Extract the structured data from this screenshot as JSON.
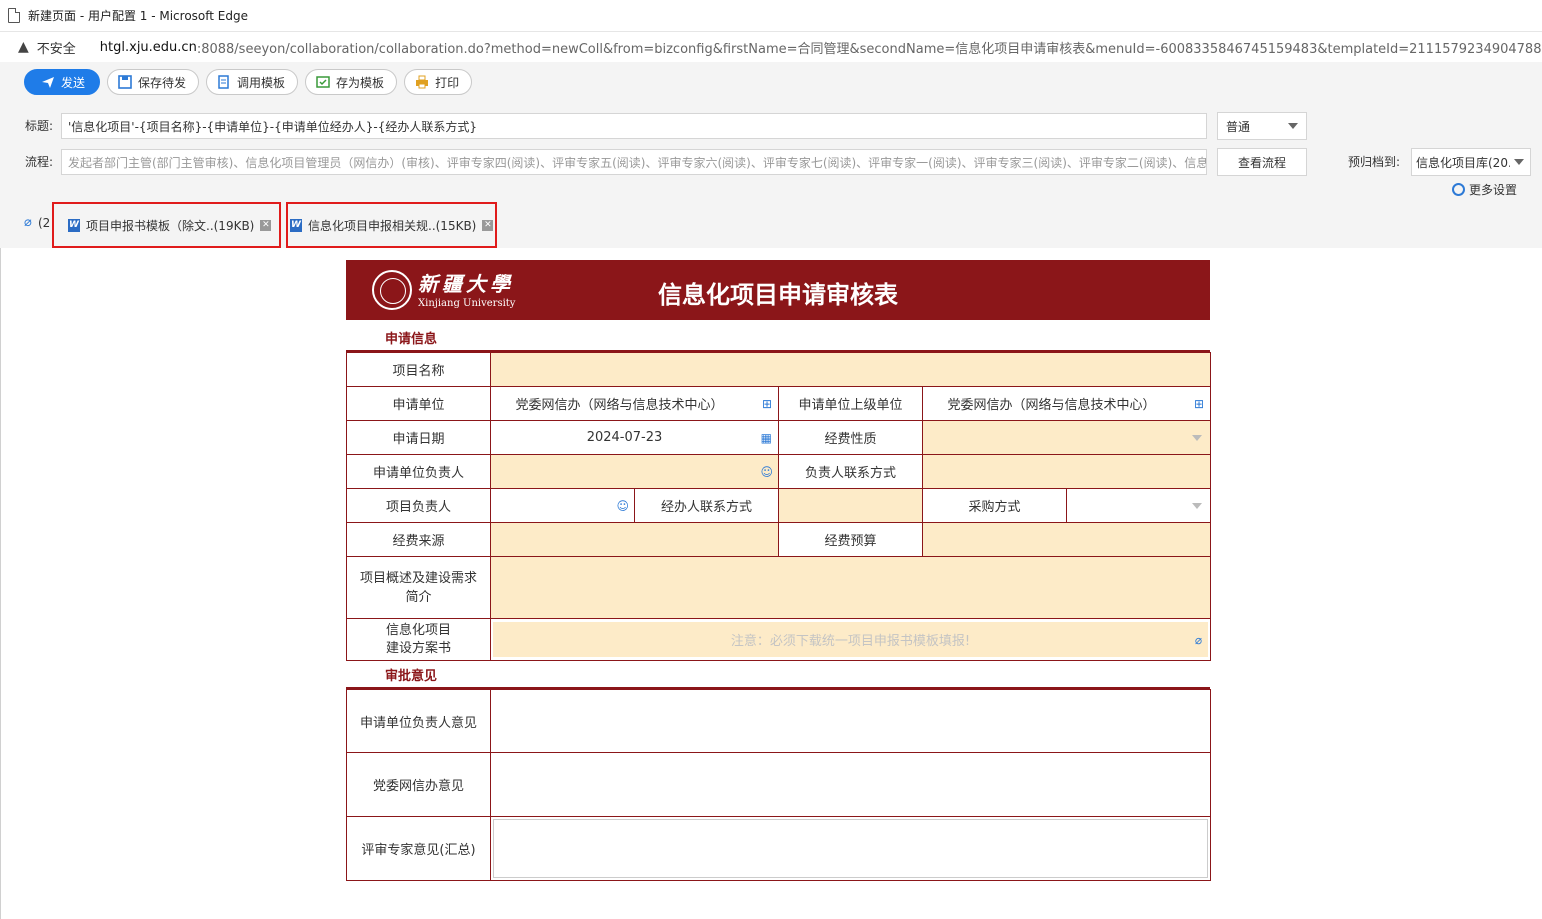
{
  "window": {
    "title": "新建页面 - 用户配置 1 - Microsoft Edge"
  },
  "address": {
    "insecure_label": "不安全",
    "url_host": "htgl.xju.edu.cn",
    "url_rest": ":8088/seeyon/collaboration/collaboration.do?method=newColl&from=bizconfig&firstName=合同管理&secondName=信息化项目申请审核表&menuId=-6008335846745159483&templateId=2111579234904788070&p"
  },
  "toolbar": {
    "send": "发送",
    "save_draft": "保存待发",
    "use_template": "调用模板",
    "save_template": "存为模板",
    "print": "打印"
  },
  "header": {
    "subject_label": "标题:",
    "subject_value": "'信息化项目'-{项目名称}-{申请单位}-{申请单位经办人}-{经办人联系方式}",
    "priority": "普通",
    "flow_label": "流程:",
    "flow_value": "发起者部门主管(部门主管审核)、信息化项目管理员（网信办）(审核)、评审专家四(阅读)、评审专家五(阅读)、评审专家六(阅读)、评审专家七(阅读)、评审专家一(阅读)、评审专家三(阅读)、评审专家二(阅读)、信息化",
    "view_flow": "查看流程",
    "archive_label": "预归档到:",
    "archive_value": "信息化项目库(20.",
    "more_settings": "更多设置"
  },
  "attachments": {
    "count": "(2",
    "items": [
      {
        "name": "项目申报书模板（除文..(19KB)"
      },
      {
        "name": "信息化项目申报相关规..(15KB)"
      }
    ]
  },
  "form": {
    "univ_cn": "新疆大學",
    "univ_en": "Xinjiang University",
    "title": "信息化项目申请审核表",
    "section_apply": "申请信息",
    "section_approve": "审批意见",
    "rows": {
      "project_name": "项目名称",
      "applicant_unit": "申请单位",
      "applicant_unit_value": "党委网信办（网络与信息技术中心）",
      "parent_unit": "申请单位上级单位",
      "parent_unit_value": "党委网信办（网络与信息技术中心）",
      "apply_date": "申请日期",
      "apply_date_value": "2024-07-23",
      "fund_nature": "经费性质",
      "unit_leader": "申请单位负责人",
      "leader_contact": "负责人联系方式",
      "project_leader": "项目负责人",
      "handler_contact": "经办人联系方式",
      "purchase_method": "采购方式",
      "fund_source": "经费来源",
      "fund_budget": "经费预算",
      "overview_1": "项目概述及建设需求",
      "overview_2": "简介",
      "plan_1": "信息化项目",
      "plan_2": "建设方案书",
      "plan_hint": "注意：必须下载统一项目申报书模板填报!"
    },
    "opinions": {
      "unit_leader_opinion": "申请单位负责人意见",
      "cac_opinion": "党委网信办意见",
      "expert_opinion": "评审专家意见(汇总)"
    }
  },
  "colors": {
    "brand": "#8b1619",
    "accent": "#1f7ce8",
    "fill": "#fdebc8",
    "highlight": "#e01b1b"
  }
}
